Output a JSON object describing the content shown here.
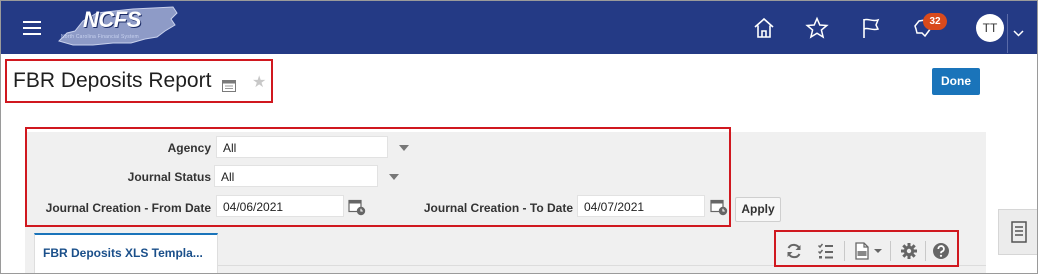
{
  "header": {
    "logo_text": "NCFS",
    "logo_subtext": "North Carolina Financial System",
    "notification_count": "32",
    "avatar_initials": "TT",
    "icons": [
      "menu-icon",
      "home-icon",
      "star-icon",
      "flag-icon",
      "notifications-icon",
      "chevron-down-icon"
    ]
  },
  "page": {
    "title": "FBR Deposits Report",
    "done_label": "Done"
  },
  "filters": {
    "agency_label": "Agency",
    "agency_value": "All",
    "journal_status_label": "Journal Status",
    "journal_status_value": "All",
    "from_date_label": "Journal Creation - From Date",
    "from_date_value": "04/06/2021",
    "to_date_label": "Journal Creation - To Date",
    "to_date_value": "04/07/2021",
    "apply_label": "Apply"
  },
  "tabs": [
    {
      "label": "FBR Deposits XLS Templa..."
    }
  ],
  "toolbar": {
    "icons": [
      "refresh-icon",
      "checklist-icon",
      "export-icon",
      "settings-icon",
      "help-icon"
    ]
  },
  "colors": {
    "header_bg": "#243a85",
    "accent": "#1a74ba",
    "highlight": "#d0181f",
    "badge": "#d94a1c"
  }
}
